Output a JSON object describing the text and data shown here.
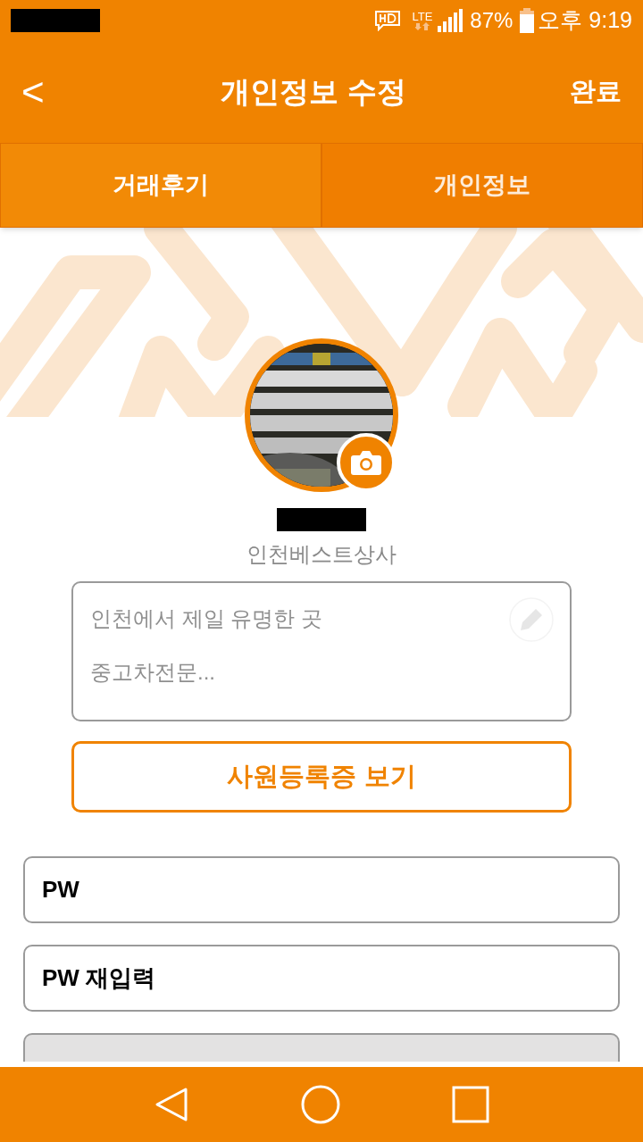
{
  "status_bar": {
    "network": "LTE",
    "battery": "87%",
    "time": "오후 9:19"
  },
  "header": {
    "back": "<",
    "title": "개인정보 수정",
    "action": "완료"
  },
  "tabs": [
    {
      "label": "거래후기",
      "selected": false
    },
    {
      "label": "개인정보",
      "selected": true
    }
  ],
  "profile": {
    "company": "인천베스트상사",
    "bio": "인천에서 제일 유명한 곳\n중고차전문..."
  },
  "view_button": "사원등록증 보기",
  "fields": [
    {
      "label": "PW",
      "disabled": false
    },
    {
      "label": "PW 재입력",
      "disabled": false
    },
    {
      "disabled": true
    }
  ]
}
